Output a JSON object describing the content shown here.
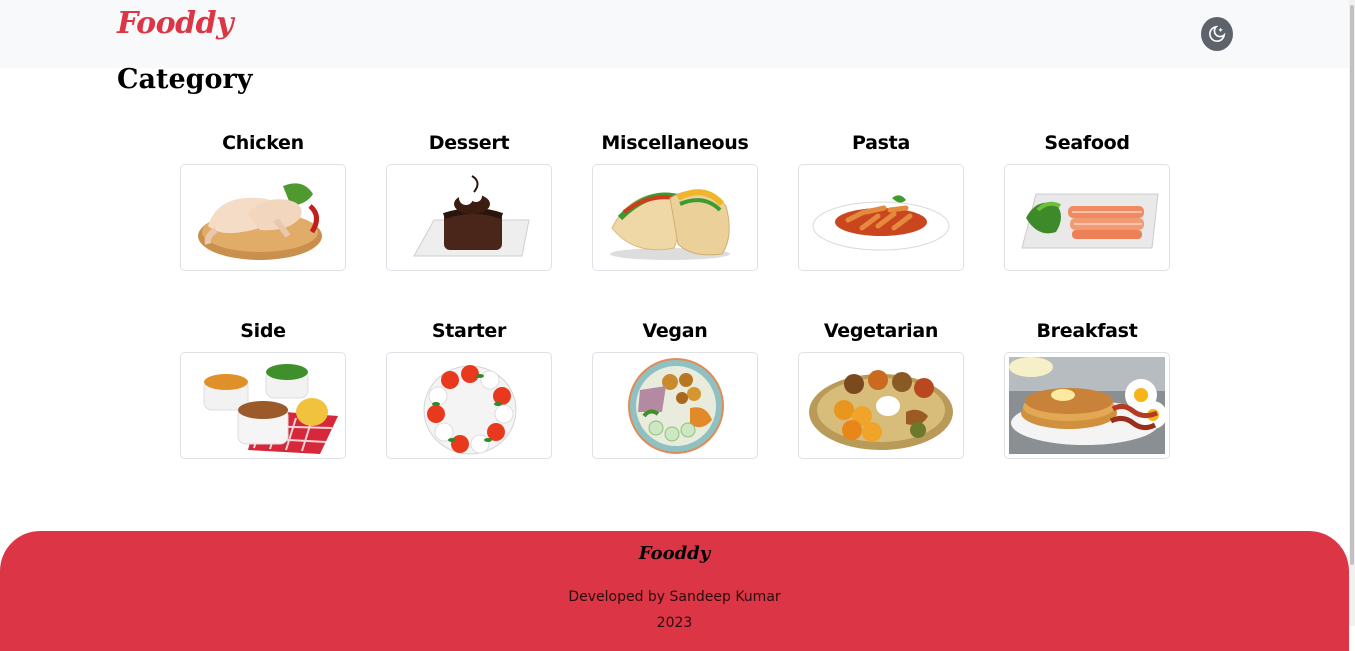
{
  "brand": {
    "name": "Fooddy",
    "color": "#dc3545"
  },
  "header": {
    "theme_toggle_icon": "moon-stars-icon"
  },
  "page": {
    "title": "Category"
  },
  "categories": [
    {
      "label": "Chicken",
      "icon": "chicken-image"
    },
    {
      "label": "Dessert",
      "icon": "dessert-image"
    },
    {
      "label": "Miscellaneous",
      "icon": "tacos-image"
    },
    {
      "label": "Pasta",
      "icon": "pasta-image"
    },
    {
      "label": "Seafood",
      "icon": "seafood-image"
    },
    {
      "label": "Side",
      "icon": "side-dishes-image"
    },
    {
      "label": "Starter",
      "icon": "caprese-image"
    },
    {
      "label": "Vegan",
      "icon": "vegan-bowl-image"
    },
    {
      "label": "Vegetarian",
      "icon": "thali-image"
    },
    {
      "label": "Breakfast",
      "icon": "pancakes-image"
    }
  ],
  "footer": {
    "brand": "Fooddy",
    "credit": "Developed by Sandeep Kumar",
    "year": "2023",
    "background": "#dc3545"
  }
}
